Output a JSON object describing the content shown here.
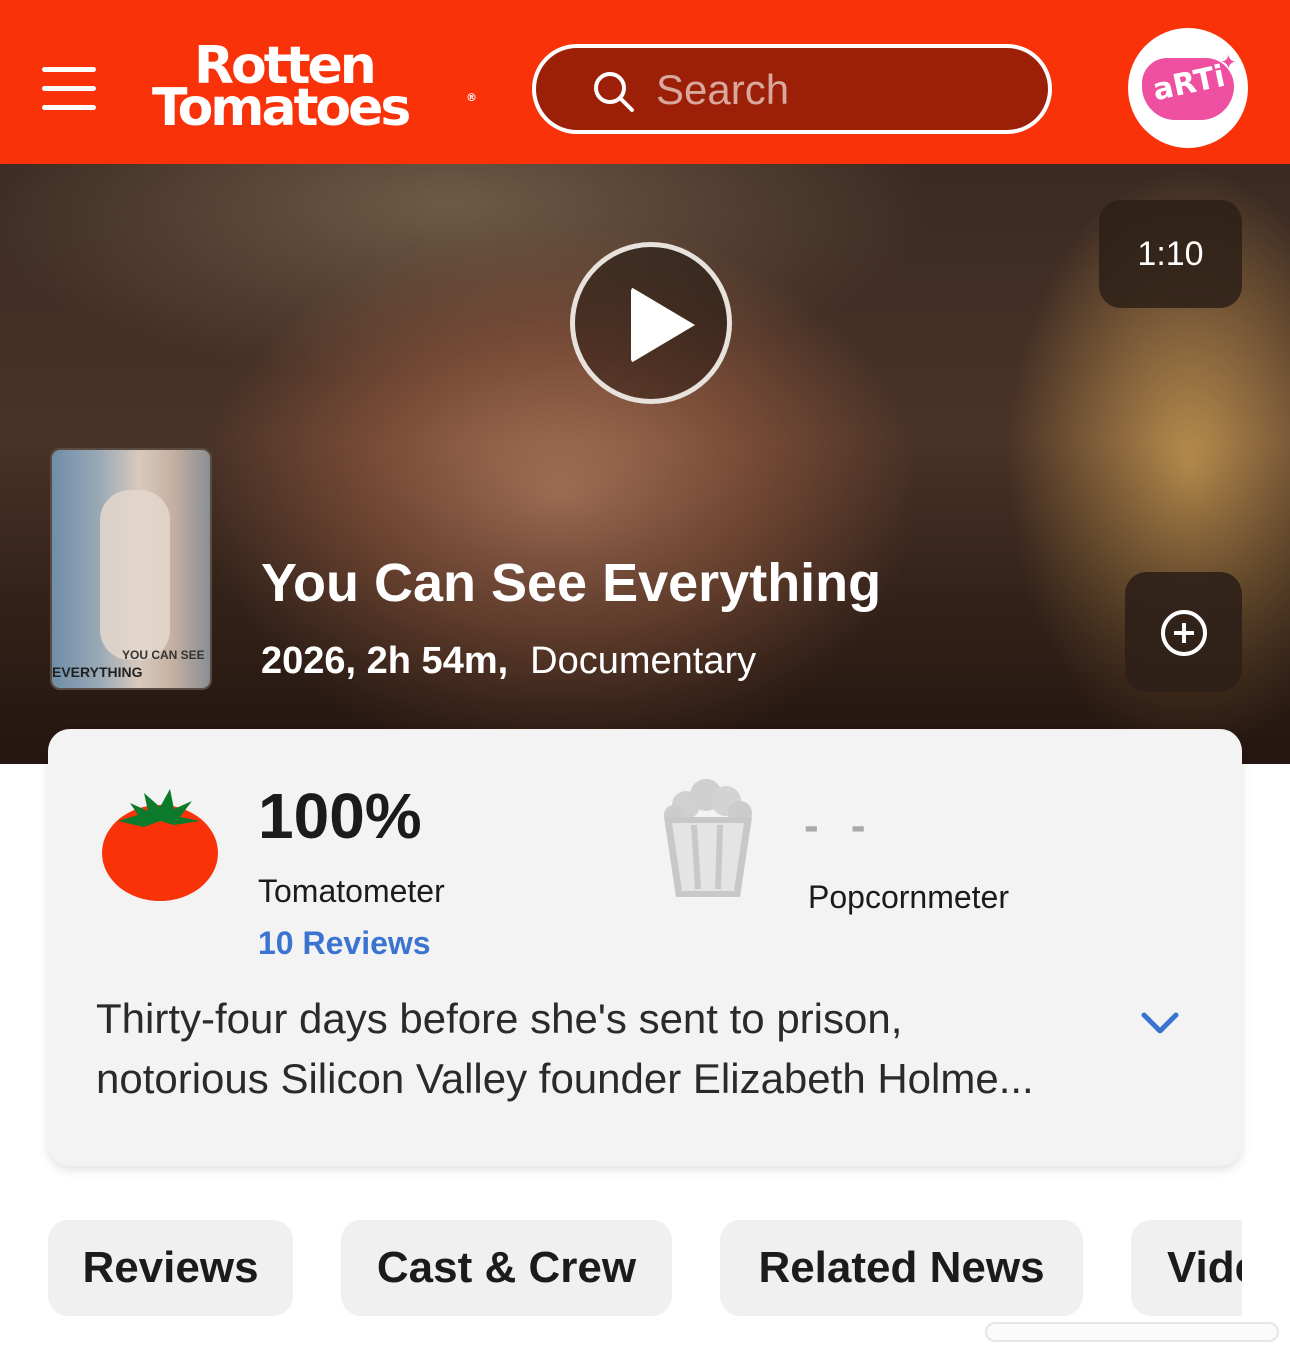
{
  "header": {
    "logo_line1": "Rotten",
    "logo_line2": "Tomatoes",
    "logo_reg": "®",
    "search_placeholder": "Search",
    "avatar_text": "aRTi",
    "brand_color": "#fa320a"
  },
  "hero": {
    "duration": "1:10",
    "poster_text_1": "YOU CAN SEE",
    "poster_text_2": "EVERYTHING",
    "title": "You Can See Everything",
    "meta_year_runtime": "2026, 2h 54m,",
    "meta_genre": "Documentary"
  },
  "scores": {
    "tomatometer_value": "100%",
    "tomatometer_label": "Tomatometer",
    "reviews_link": "10 Reviews",
    "popcornmeter_value": "- -",
    "popcornmeter_label": "Popcornmeter",
    "link_color": "#3a74d0"
  },
  "synopsis": {
    "line1": "Thirty-four days before she's sent to prison,",
    "line2": "notorious Silicon Valley founder Elizabeth Holme..."
  },
  "tabs": [
    "Reviews",
    "Cast & Crew",
    "Related News",
    "Videos"
  ]
}
